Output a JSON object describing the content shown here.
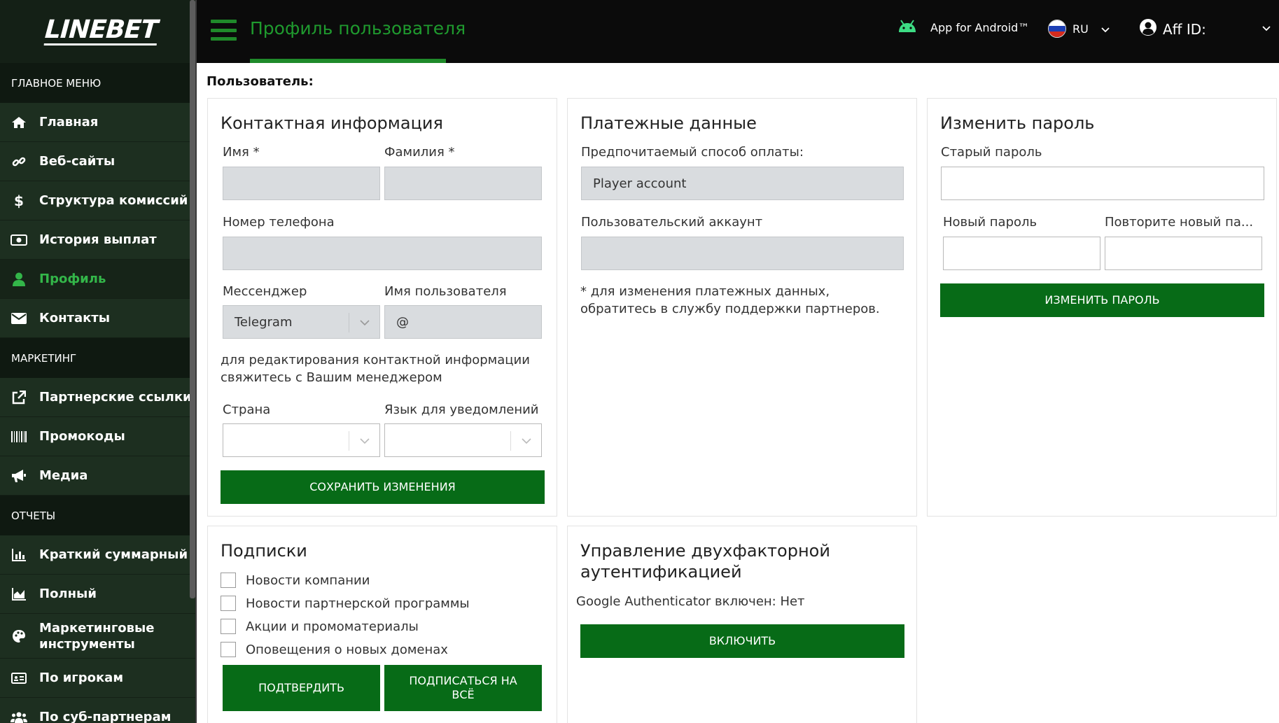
{
  "sidebar": {
    "logo": "LINEBET",
    "sections": {
      "main": "ГЛАВНОЕ МЕНЮ",
      "marketing": "МАРКЕТИНГ",
      "reports": "ОТЧЕТЫ"
    },
    "main_items": [
      {
        "label": "Главная",
        "icon": "home-icon"
      },
      {
        "label": "Веб-сайты",
        "icon": "link-icon"
      },
      {
        "label": "Структура комиссий",
        "icon": "dollar-icon"
      },
      {
        "label": "История выплат",
        "icon": "money-icon"
      },
      {
        "label": "Профиль",
        "icon": "user-icon"
      },
      {
        "label": "Контакты",
        "icon": "envelope-icon"
      }
    ],
    "marketing_items": [
      {
        "label": "Партнерские ссылки",
        "icon": "external-link-icon"
      },
      {
        "label": "Промокоды",
        "icon": "barcode-icon"
      },
      {
        "label": "Медиа",
        "icon": "megaphone-icon"
      }
    ],
    "report_items": [
      {
        "label": "Краткий суммарный",
        "icon": "bar-chart-icon"
      },
      {
        "label": "Полный",
        "icon": "area-chart-icon"
      },
      {
        "label": "Маркетинговые инструменты",
        "icon": "palette-icon"
      },
      {
        "label": "По игрокам",
        "icon": "id-card-icon"
      },
      {
        "label": "По суб-партнерам",
        "icon": "users-icon"
      }
    ],
    "active_color": "#33b649"
  },
  "topbar": {
    "title": "Профиль пользователя",
    "android_label": "App for Android™",
    "language": "RU",
    "aff_label": "Aff ID:"
  },
  "user_heading": "Пользователь:",
  "contact": {
    "title": "Контактная информация",
    "first_name_label": "Имя *",
    "last_name_label": "Фамилия *",
    "first_name": "",
    "last_name": "",
    "phone_label": "Номер телефона",
    "phone": "",
    "messenger_label": "Мессенджер",
    "messenger": "Telegram",
    "username_label": "Имя пользователя",
    "username": "@",
    "note": "для редактирования контактной информации свяжитесь с Вашим менеджером",
    "country_label": "Страна",
    "country": "",
    "notify_lang_label": "Язык для уведомлений",
    "notify_lang": "",
    "save_button": "СОХРАНИТЬ ИЗМЕНЕНИЯ"
  },
  "payment": {
    "title": "Платежные данные",
    "method_label": "Предпочитаемый способ оплаты:",
    "method": "Player account",
    "account_label": "Пользовательский аккаунт",
    "account": "",
    "note": "* для изменения платежных данных, обратитесь в службу поддержки партнеров."
  },
  "password": {
    "title": "Изменить пароль",
    "old_label": "Старый пароль",
    "new_label": "Новый пароль",
    "repeat_label": "Повторите новый па...",
    "button": "ИЗМЕНИТЬ ПАРОЛЬ"
  },
  "subscriptions": {
    "title": "Подписки",
    "items": [
      {
        "label": "Новости компании",
        "checked": false
      },
      {
        "label": "Новости партнерской программы",
        "checked": false
      },
      {
        "label": "Акции и промоматериалы",
        "checked": false
      },
      {
        "label": "Оповещения о новых доменах",
        "checked": false
      }
    ],
    "confirm_button": "ПОДТВЕРДИТЬ",
    "subscribe_all_button": "ПОДПИСАТЬСЯ НА ВСЁ"
  },
  "twofa": {
    "title": "Управление двухфакторной аутентификацией",
    "status": "Google Authenticator включен: Нет",
    "button": "ВКЛЮЧИТЬ"
  },
  "colors": {
    "brand_green": "#076b17",
    "topbar_bg": "#0b0b0b",
    "sidebar_bg": "#1d2f20"
  }
}
